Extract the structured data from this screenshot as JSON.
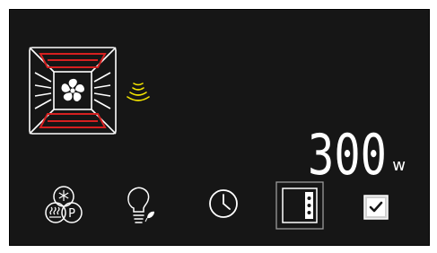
{
  "power": {
    "value": "300",
    "unit": "w"
  },
  "colors": {
    "panel_bg": "#161616",
    "frame_border": "#ffffff",
    "heating_element": "#d52020",
    "waves": "#f2e300",
    "text": "#ffffff"
  },
  "icons": {
    "oven_mode": "fan-with-top-bottom-heat-icon",
    "microwave": "microwave-waves-icon",
    "functions": "snowflake-steam-p-icon",
    "lamp": "eco-light-bulb-icon",
    "timer": "clock-icon",
    "door": "oven-door-icon",
    "confirm": "checkmark-icon"
  }
}
